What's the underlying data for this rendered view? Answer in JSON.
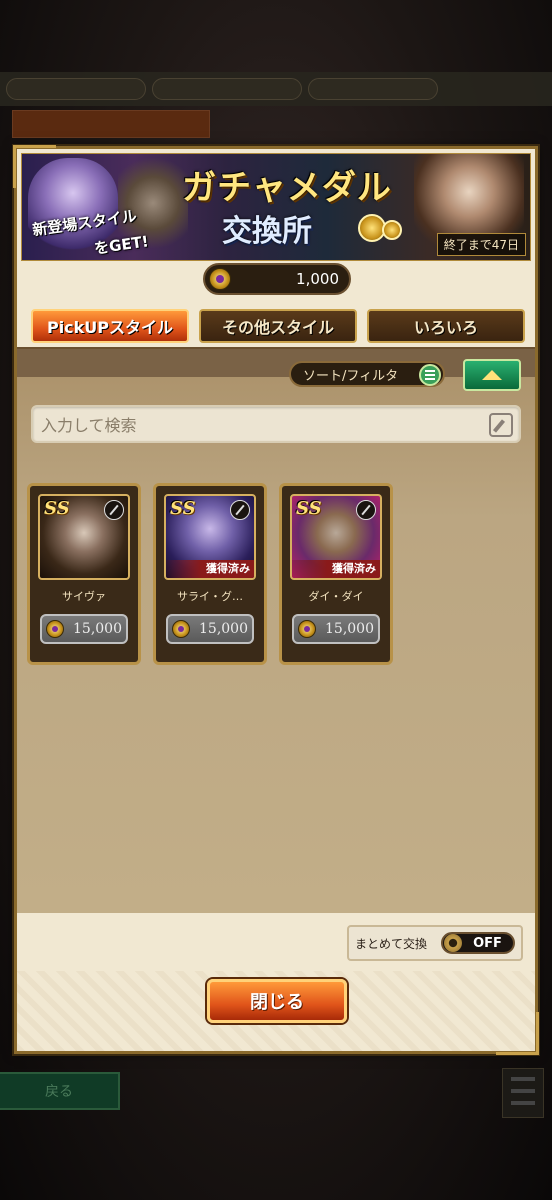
{
  "background": {
    "bg_back_label": "戻る"
  },
  "banner": {
    "title": "ガチャメダル",
    "subtitle": "交換所",
    "new_style_1": "新登場スタイル",
    "new_style_2": "をGET!",
    "deadline": "終了まで47日"
  },
  "medal": {
    "value": "1,000"
  },
  "tabs": [
    {
      "label": "PickUPスタイル",
      "active": true
    },
    {
      "label": "その他スタイル",
      "active": false
    },
    {
      "label": "いろいろ",
      "active": false
    }
  ],
  "sort": {
    "label": "ソート/フィルタ"
  },
  "search": {
    "placeholder": "入力して検索"
  },
  "cards": [
    {
      "rank": "SS",
      "name": "サイヴァ",
      "price": "15,000",
      "obtained": ""
    },
    {
      "rank": "SS",
      "name": "サライ・グ…",
      "price": "15,000",
      "obtained": "獲得済み"
    },
    {
      "rank": "SS",
      "name": "ダイ・ダイ",
      "price": "15,000",
      "obtained": "獲得済み"
    }
  ],
  "bulk": {
    "label": "まとめて交換",
    "state": "OFF"
  },
  "close": {
    "label": "閉じる"
  },
  "colors": {
    "accent": "#e0541a",
    "frame": "#c9a24c",
    "panel": "#f1e8d2"
  }
}
